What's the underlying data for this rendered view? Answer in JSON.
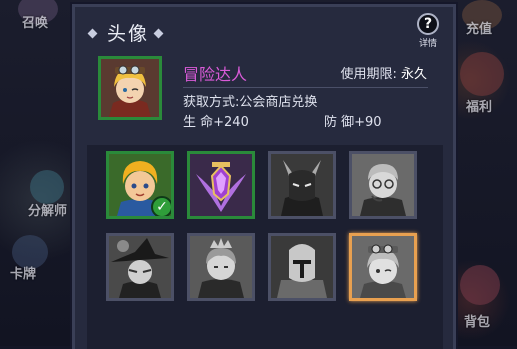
{
  "background": {
    "labels": [
      {
        "id": "summon",
        "text": "召唤"
      },
      {
        "id": "decompose",
        "text": "分解师"
      },
      {
        "id": "card",
        "text": "卡牌"
      },
      {
        "id": "recharge",
        "text": "充值"
      },
      {
        "id": "welfare",
        "text": "福利"
      },
      {
        "id": "bag",
        "text": "背包"
      }
    ]
  },
  "panel": {
    "title": "头像",
    "help_label": "详情"
  },
  "selected_avatar": {
    "name": "冒险达人",
    "period_label": "使用期限:",
    "period_value": "永久",
    "obtain_text": "获取方式:公会商店兑换",
    "stat_hp": "生  命+240",
    "stat_def": "防  御+90"
  },
  "avatars": [
    {
      "id": "blonde-hero",
      "owned": true,
      "current": true,
      "selected": false,
      "color": "color"
    },
    {
      "id": "purple-crest",
      "owned": true,
      "current": false,
      "selected": false,
      "color": "color"
    },
    {
      "id": "horned-demon",
      "owned": false,
      "current": false,
      "selected": false,
      "color": "gray"
    },
    {
      "id": "glasses-man",
      "owned": false,
      "current": false,
      "selected": false,
      "color": "gray"
    },
    {
      "id": "witch-hat",
      "owned": false,
      "current": false,
      "selected": false,
      "color": "gray"
    },
    {
      "id": "crowned-prince",
      "owned": false,
      "current": false,
      "selected": false,
      "color": "gray"
    },
    {
      "id": "armored-knight",
      "owned": false,
      "current": false,
      "selected": false,
      "color": "gray"
    },
    {
      "id": "adventurer-girl",
      "owned": false,
      "current": false,
      "selected": true,
      "color": "gray"
    }
  ],
  "colors": {
    "owned_border": "#2a8a3a",
    "selected_border": "#e8a050",
    "name_color": "#d95bd8"
  }
}
